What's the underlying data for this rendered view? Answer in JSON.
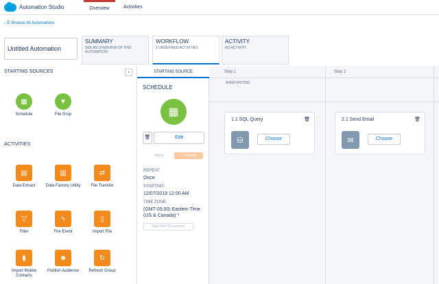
{
  "app": {
    "title": "Automation Studio"
  },
  "tabs": [
    {
      "label": "Overview",
      "active": true
    },
    {
      "label": "Activities",
      "active": false
    }
  ],
  "breadcrumb": {
    "label": "Browse All Automations"
  },
  "automation_name": {
    "value": "Untitled Automation"
  },
  "section_tabs": [
    {
      "title": "SUMMARY",
      "subtitle": "SEE AN OVERVIEW OF THIS AUTOMATION"
    },
    {
      "title": "WORKFLOW",
      "subtitle": "2 UNDEFINED ACTIVITIES",
      "active": true
    },
    {
      "title": "ACTIVITY",
      "subtitle": "NO ACTIVITY."
    }
  ],
  "left_panel": {
    "starting_sources_title": "STARTING SOURCES",
    "collapse_icon": "chevron-left-icon",
    "starting_sources": [
      {
        "label": "Schedule",
        "icon": "calendar-icon"
      },
      {
        "label": "File Drop",
        "icon": "folder-icon"
      }
    ],
    "activities_title": "ACTIVITIES",
    "activities": [
      {
        "label": "Data Extract",
        "icon": "data-extract-icon"
      },
      {
        "label": "Data Factory Utility",
        "icon": "data-factory-icon"
      },
      {
        "label": "File Transfer",
        "icon": "file-transfer-icon"
      },
      {
        "label": "Filter",
        "icon": "filter-icon"
      },
      {
        "label": "Fire Event",
        "icon": "fire-event-icon"
      },
      {
        "label": "Import File",
        "icon": "import-file-icon"
      },
      {
        "label": "Import Mobile Contacts",
        "icon": "import-mobile-icon"
      },
      {
        "label": "Publish Audience",
        "icon": "publish-audience-icon"
      },
      {
        "label": "Refresh Group",
        "icon": "refresh-group-icon"
      }
    ]
  },
  "canvas": {
    "starting_source_header": "STARTING SOURCE",
    "step1_header": "Step 1",
    "step2_header": "Step 2",
    "annotations_label": "ANNOTATIONS",
    "schedule": {
      "title": "SCHEDULE",
      "edit_label": "Edit",
      "toggle_active": "Active",
      "toggle_paused": "✓ Paused",
      "repeat_label": "REPEAT:",
      "repeat_value": "Once",
      "starting_label": "STARTING:",
      "starting_value": "12/07/2019 12:00 AM",
      "timezone_label": "TIME ZONE:",
      "timezone_value": "(GMT-05:00) Eastern Time (US & Canada) *",
      "skip_label": "Skip Next Occurrence"
    },
    "cards": [
      {
        "title": "1.1 SQL Query",
        "choose_label": "Choose",
        "icon": "sql-query-icon"
      },
      {
        "title": "2.1 Send Email",
        "choose_label": "Choose",
        "icon": "email-icon"
      }
    ]
  },
  "colors": {
    "accent": "#0070d2",
    "active_tab_border": "#c23934",
    "green": "#7ac142",
    "orange": "#f38b1c"
  }
}
